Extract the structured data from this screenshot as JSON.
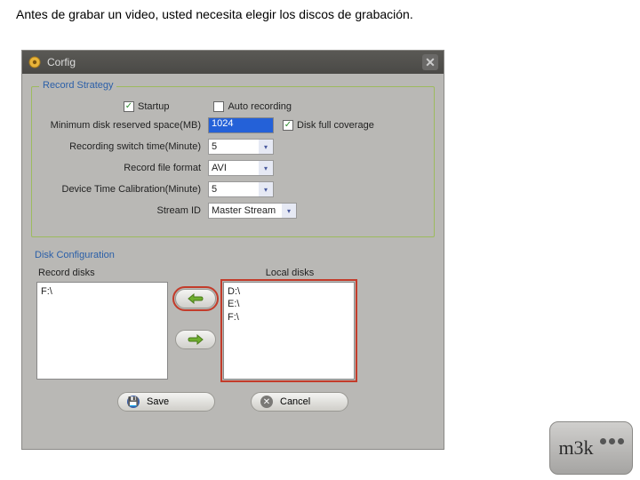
{
  "instruction": "Antes de grabar un video, usted necesita elegir los discos de grabación.",
  "dialog": {
    "title": "Corfig",
    "strategy": {
      "legend": "Record Strategy",
      "startup": {
        "label": "Startup",
        "checked": true
      },
      "auto": {
        "label": "Auto recording",
        "checked": false
      },
      "minDisk": {
        "label": "Minimum disk reserved space(MB)",
        "value": "1024"
      },
      "diskFull": {
        "label": "Disk full coverage",
        "checked": true
      },
      "switchTime": {
        "label": "Recording switch time(Minute)",
        "value": "5"
      },
      "fileFormat": {
        "label": "Record file format",
        "value": "AVI"
      },
      "calibration": {
        "label": "Device Time Calibration(Minute)",
        "value": "5"
      },
      "streamId": {
        "label": "Stream ID",
        "value": "Master Stream"
      }
    },
    "disks": {
      "legend": "Disk Configuration",
      "recordLabel": "Record disks",
      "localLabel": "Local disks",
      "record": [
        "F:\\"
      ],
      "local": [
        "D:\\",
        "E:\\",
        "F:\\"
      ]
    },
    "buttons": {
      "save": "Save",
      "cancel": "Cancel"
    }
  },
  "logo": "m3k"
}
